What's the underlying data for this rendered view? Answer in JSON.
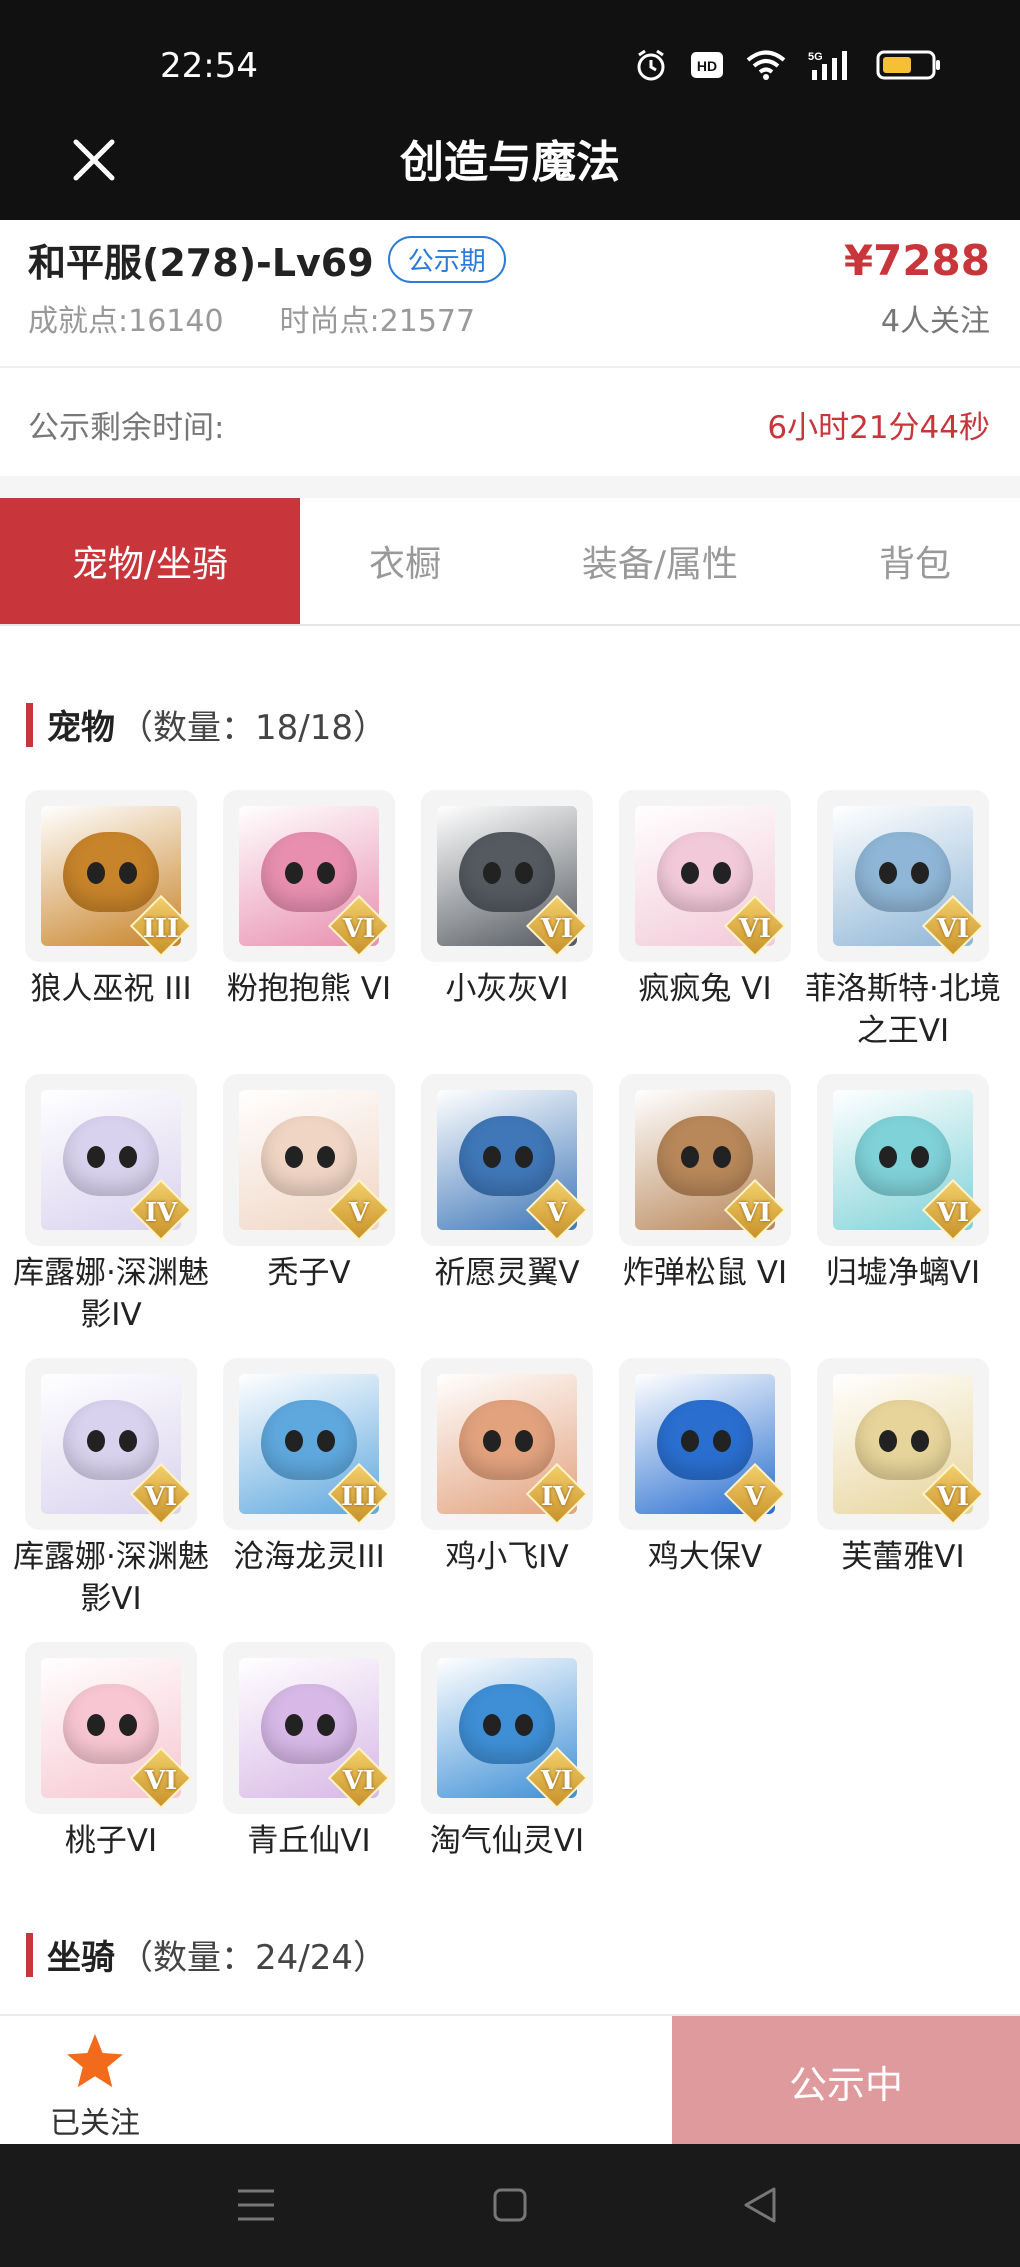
{
  "status_bar": {
    "time": "22:54",
    "icons": [
      "alarm-icon",
      "hd-icon",
      "wifi-icon",
      "5g-signal-icon",
      "battery-icon"
    ]
  },
  "app_bar": {
    "title": "创造与魔法"
  },
  "info": {
    "server_name": "和平服(278)-Lv69",
    "phase_badge": "公示期",
    "price": "¥7288",
    "achievement": "成就点:16140",
    "fashion": "时尚点:21577",
    "followers": "4人关注"
  },
  "timer": {
    "label": "公示剩余时间:",
    "value": "6小时21分44秒"
  },
  "tabs": [
    {
      "label": "宠物/坐骑",
      "active": true
    },
    {
      "label": "衣橱",
      "active": false
    },
    {
      "label": "装备/属性",
      "active": false
    },
    {
      "label": "背包",
      "active": false
    }
  ],
  "pets_section": {
    "title": "宠物",
    "count": "（数量：18/18）"
  },
  "pets": [
    {
      "name": "狼人巫祝 III",
      "rank": "III",
      "color": "#c8842a"
    },
    {
      "name": "粉抱抱熊 VI",
      "rank": "VI",
      "color": "#e88fb0"
    },
    {
      "name": "小灰灰VI",
      "rank": "VI",
      "color": "#555a60"
    },
    {
      "name": "疯疯兔 VI",
      "rank": "VI",
      "color": "#f2c9d8"
    },
    {
      "name": "菲洛斯特·北境之王VI",
      "rank": "VI",
      "color": "#8fb6d6"
    },
    {
      "name": "库露娜·深渊魅影IV",
      "rank": "IV",
      "color": "#d9d2ee"
    },
    {
      "name": "秃子V",
      "rank": "V",
      "color": "#f0d5c4"
    },
    {
      "name": "祈愿灵翼V",
      "rank": "V",
      "color": "#3f77b8"
    },
    {
      "name": "炸弹松鼠 VI",
      "rank": "VI",
      "color": "#b8875a"
    },
    {
      "name": "归墟净螭VI",
      "rank": "VI",
      "color": "#7fd2d8"
    },
    {
      "name": "库露娜·深渊魅影VI",
      "rank": "VI",
      "color": "#d9d2ee"
    },
    {
      "name": "沧海龙灵III",
      "rank": "III",
      "color": "#5fa8de"
    },
    {
      "name": "鸡小飞IV",
      "rank": "IV",
      "color": "#e2a27e"
    },
    {
      "name": "鸡大保V",
      "rank": "V",
      "color": "#2a6fd0"
    },
    {
      "name": "芙蕾雅VI",
      "rank": "VI",
      "color": "#e7d49a"
    },
    {
      "name": "桃子VI",
      "rank": "VI",
      "color": "#f7c6d2"
    },
    {
      "name": "青丘仙VI",
      "rank": "VI",
      "color": "#d7b8e6"
    },
    {
      "name": "淘气仙灵VI",
      "rank": "VI",
      "color": "#3e8fd6"
    }
  ],
  "mounts_section": {
    "title": "坐骑",
    "count": "（数量：24/24）"
  },
  "bottom_bar": {
    "follow_label": "已关注",
    "status_label": "公示中"
  },
  "colors": {
    "accent": "#c8353a",
    "badge_blue": "#2b7bd8",
    "status_button": "#de9a9c"
  }
}
